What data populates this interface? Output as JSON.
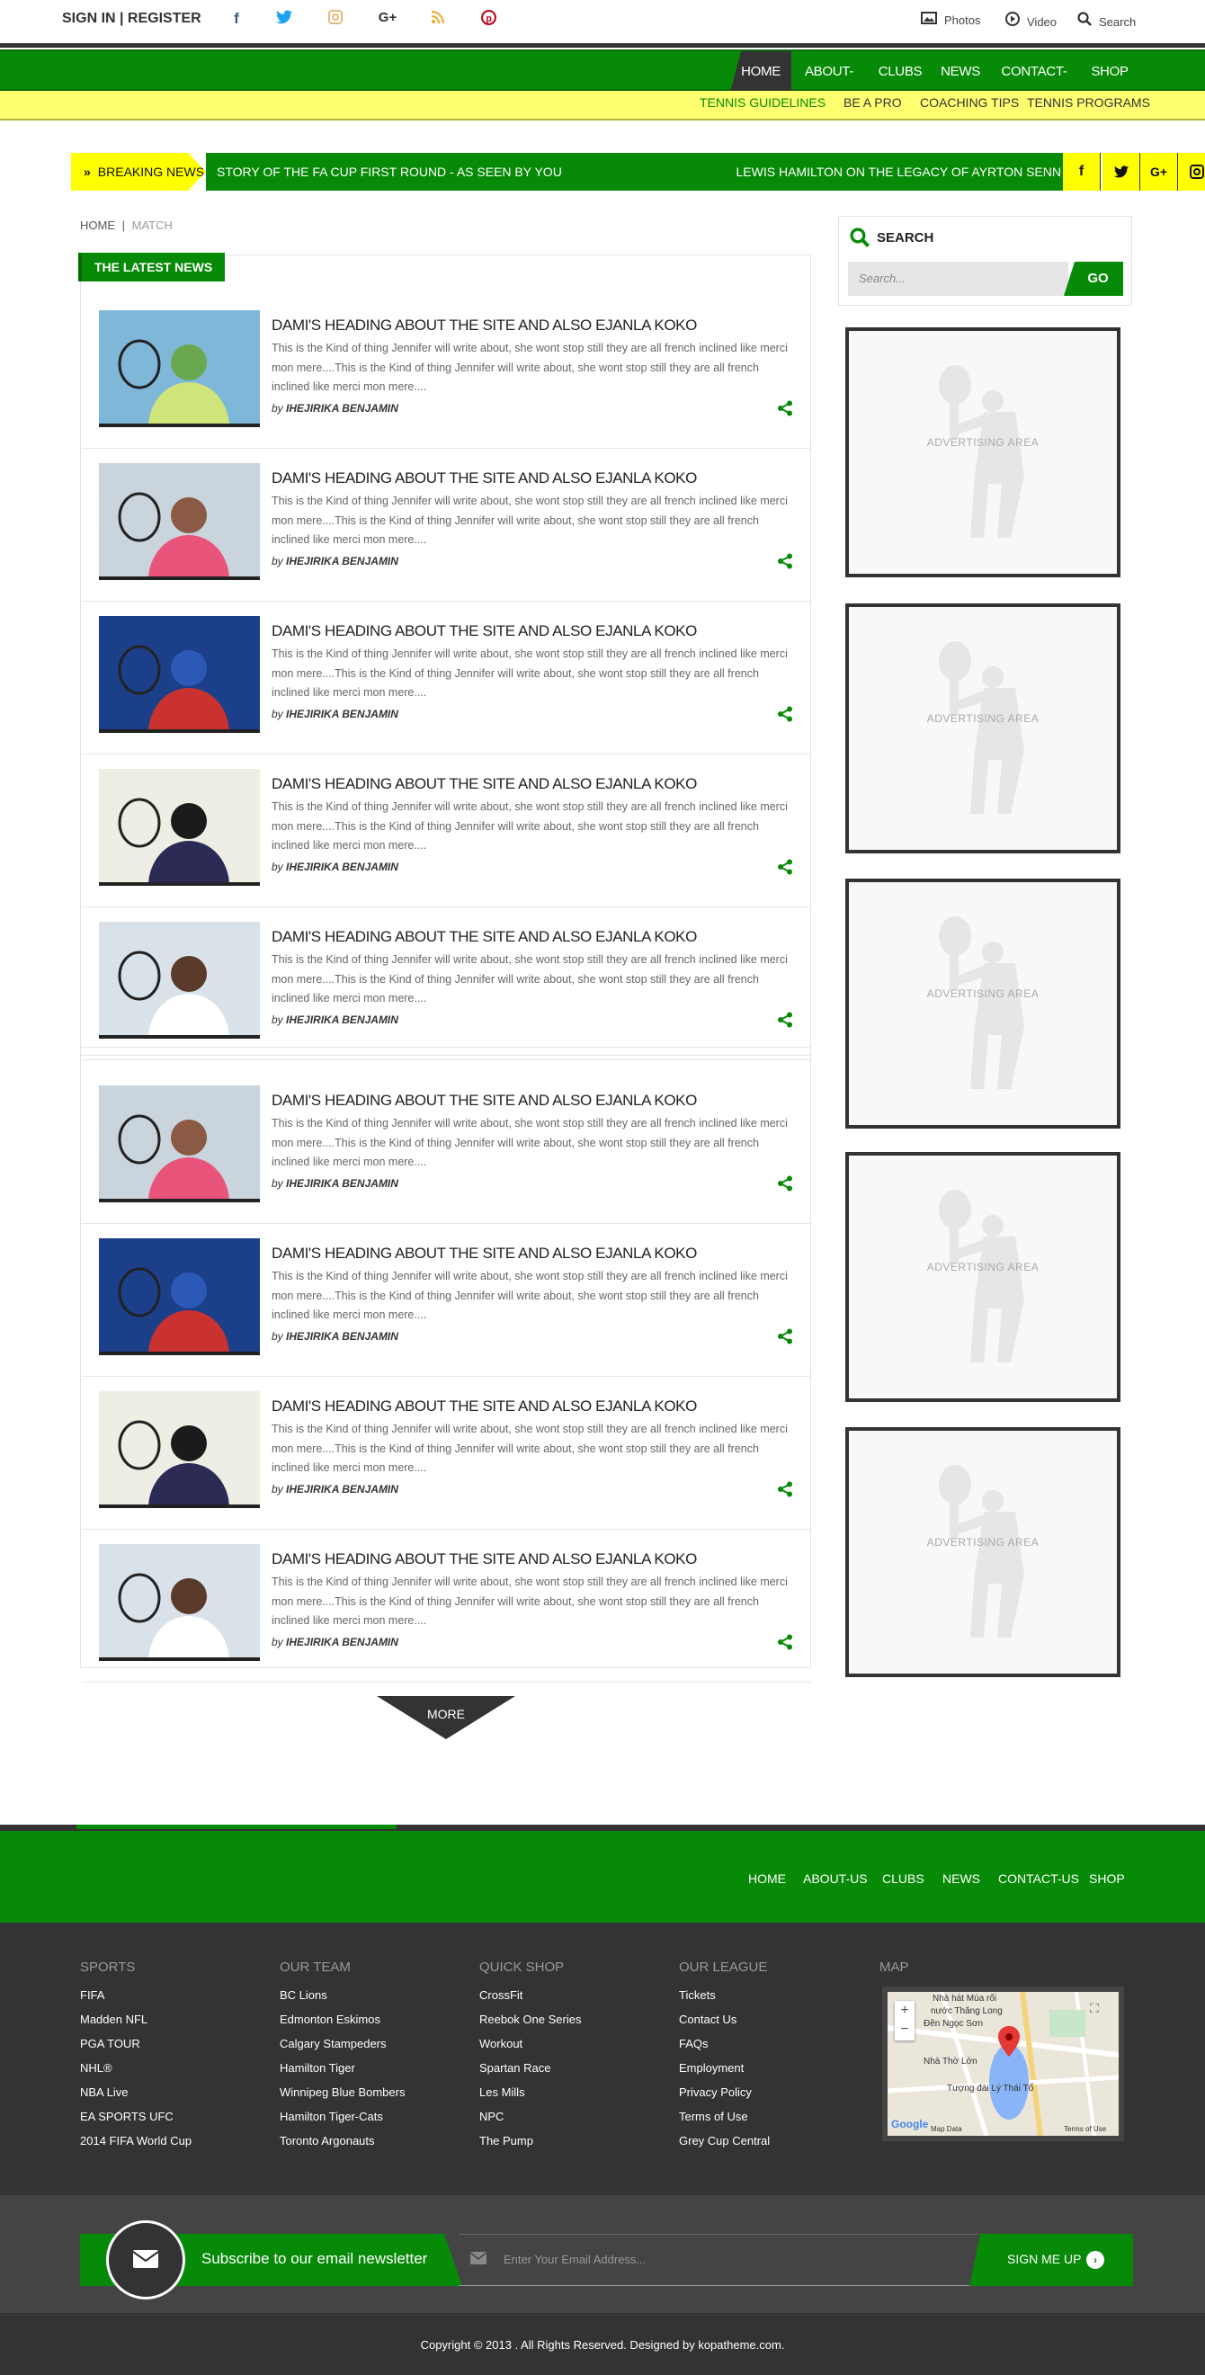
{
  "topbar": {
    "signin": "SIGN IN | REGISTER",
    "social": [
      "f",
      "t",
      "ig",
      "g+",
      "rss",
      "p"
    ],
    "photos": "Photos",
    "video": "Video",
    "search": "Search"
  },
  "nav": {
    "items": [
      "HOME",
      "ABOUT-US",
      "CLUBS",
      "NEWS",
      "CONTACT-US",
      "SHOP"
    ],
    "sub": [
      "TENNIS GUIDELINES",
      "BE A PRO",
      "COACHING TIPS",
      "TENNIS PROGRAMS"
    ]
  },
  "breaking": {
    "label": "BREAKING NEWS",
    "item1": "STORY OF THE FA CUP FIRST ROUND - AS SEEN BY YOU",
    "item2": "LEWIS HAMILTON ON THE LEGACY OF AYRTON SENN"
  },
  "breadcrumb": {
    "home": "HOME",
    "sep": "|",
    "current": "MATCH"
  },
  "latest": {
    "title": "THE LATEST NEWS",
    "article_title": "DAMI'S HEADING ABOUT THE SITE AND ALSO EJANLA KOKO",
    "excerpt": "This is the Kind of thing Jennifer will write about, she wont stop still they are all french inclined like merci mon mere....This is the Kind of thing Jennifer will write about, she wont stop still they are all french inclined like merci mon mere....",
    "by": "by",
    "author": "IHEJIRIKA BENJAMIN",
    "more": "MORE"
  },
  "sidebar": {
    "search_title": "SEARCH",
    "search_placeholder": "Search...",
    "go": "GO",
    "ad_text": "ADVERTISING AREA"
  },
  "footer_nav": [
    "HOME",
    "ABOUT-US",
    "CLUBS",
    "NEWS",
    "CONTACT-US",
    "SHOP"
  ],
  "footer": {
    "sports": {
      "title": "SPORTS",
      "items": [
        "FIFA",
        "Madden NFL",
        "PGA TOUR",
        "NHL®",
        "NBA Live",
        "EA SPORTS UFC",
        "2014 FIFA World Cup"
      ]
    },
    "team": {
      "title": "OUR TEAM",
      "items": [
        "BC Lions",
        "Edmonton Eskimos",
        "Calgary Stampeders",
        "Hamilton Tiger",
        "Winnipeg Blue Bombers",
        "Hamilton Tiger-Cats",
        "Toronto Argonauts"
      ]
    },
    "shop": {
      "title": "QUICK SHOP",
      "items": [
        "CrossFit",
        "Reebok One Series",
        "Workout",
        "Spartan Race",
        "Les Mills",
        "NPC",
        "The Pump"
      ]
    },
    "league": {
      "title": "OUR LEAGUE",
      "items": [
        "Tickets",
        "Contact Us",
        "FAQs",
        "Employment",
        "Privacy Policy",
        "Terms of Use",
        "Grey Cup Central"
      ]
    },
    "map": {
      "title": "MAP",
      "plus": "+",
      "minus": "−",
      "label1": "Nhà hát Múa rối",
      "label2": "nước Thăng Long",
      "label3": "Đền Ngọc Sơn",
      "label4": "Nhà Thờ Lớn",
      "label5": "Tượng đài Lý Thái Tổ",
      "mapdata": "Map Data",
      "terms": "Terms of Use",
      "google": "Google"
    }
  },
  "newsletter": {
    "text": "Subscribe to our email newsletter",
    "placeholder": "Enter Your Email Address...",
    "button": "SIGN ME UP"
  },
  "copyright": "Copyright © 2013 . All Rights Reserved. Designed by kopatheme.com.",
  "colors": {
    "green": "#078a07",
    "yellow": "#ffff00",
    "dark": "#333333"
  }
}
